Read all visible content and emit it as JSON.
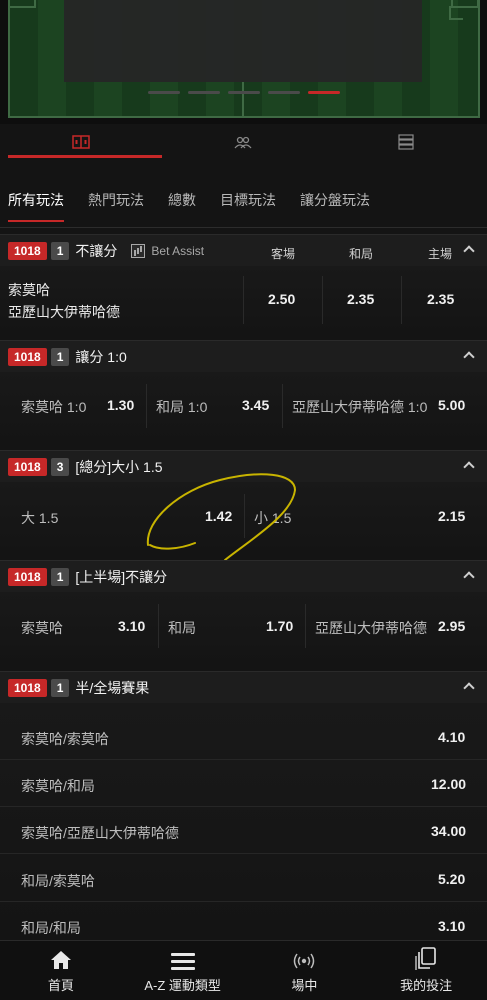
{
  "category_tabs": [
    "所有玩法",
    "熱門玩法",
    "總數",
    "目標玩法",
    "讓分盤玩法"
  ],
  "icons": {
    "tab1": "scoreboard-icon",
    "tab2": "players-icon",
    "tab3": "list-icon",
    "bet_assist": "chart-icon"
  },
  "markets": {
    "m1": {
      "id": "1018",
      "count": "1",
      "title": "不讓分",
      "bet_assist": "Bet Assist",
      "cols": [
        "客場",
        "和局",
        "主場"
      ],
      "team1": "索莫哈",
      "team2": "亞歷山大伊蒂哈德",
      "odds": [
        "2.50",
        "2.35",
        "2.35"
      ]
    },
    "m2": {
      "id": "1018",
      "count": "1",
      "title": "讓分 1:0",
      "labels": [
        "索莫哈 1:0",
        "和局 1:0",
        "亞歷山大伊蒂哈德 1:0"
      ],
      "odds": [
        "1.30",
        "3.45",
        "5.00"
      ]
    },
    "m3": {
      "id": "1018",
      "count": "3",
      "title": "[總分]大小 1.5",
      "labels": [
        "大 1.5",
        "小 1.5"
      ],
      "odds": [
        "1.42",
        "2.15"
      ]
    },
    "m4": {
      "id": "1018",
      "count": "1",
      "title": "[上半場]不讓分",
      "labels": [
        "索莫哈",
        "和局",
        "亞歷山大伊蒂哈德"
      ],
      "odds": [
        "3.10",
        "1.70",
        "2.95"
      ]
    },
    "m5": {
      "id": "1018",
      "count": "1",
      "title": "半/全場賽果",
      "rows": [
        {
          "label": "索莫哈/索莫哈",
          "odd": "4.10"
        },
        {
          "label": "索莫哈/和局",
          "odd": "12.00"
        },
        {
          "label": "索莫哈/亞歷山大伊蒂哈德",
          "odd": "34.00"
        },
        {
          "label": "和局/索莫哈",
          "odd": "5.20"
        },
        {
          "label": "和局/和局",
          "odd": "3.10"
        }
      ]
    }
  },
  "bottom_nav": [
    "首頁",
    "A-Z 運動類型",
    "場中",
    "我的投注"
  ],
  "colors": {
    "accent": "#c62828",
    "annotation": "#c8b400"
  }
}
